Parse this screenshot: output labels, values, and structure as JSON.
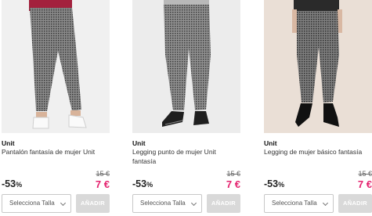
{
  "products": [
    {
      "brand": "Unit",
      "title": "Pantalón fantasía de mujer Unit",
      "old_price": "15 €",
      "discount_value": "-53",
      "discount_unit": "%",
      "new_price": "7 €",
      "size_select_label": "Selecciona Talla",
      "add_label": "AÑADIR",
      "image": "pantalon-fantasia-photo"
    },
    {
      "brand": "Unit",
      "title": "Legging punto de mujer Unit fantasía",
      "old_price": "15 €",
      "discount_value": "-53",
      "discount_unit": "%",
      "new_price": "7 €",
      "size_select_label": "Selecciona Talla",
      "add_label": "AÑADIR",
      "image": "legging-punto-photo"
    },
    {
      "brand": "Unit",
      "title": "Legging de mujer básico fantasía",
      "old_price": "15 €",
      "discount_value": "-53",
      "discount_unit": "%",
      "new_price": "7 €",
      "size_select_label": "Selecciona Talla",
      "add_label": "AÑADIR",
      "image": "legging-basico-photo"
    }
  ],
  "colors": {
    "sale_price": "#e4226e",
    "add_button_bg": "#d9d9d9"
  }
}
